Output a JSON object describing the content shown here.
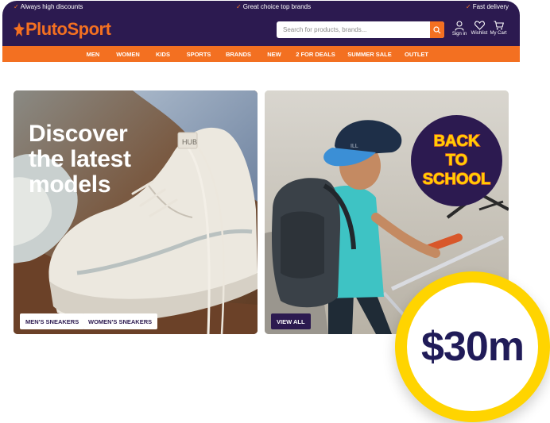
{
  "header": {
    "usps": [
      "Always high discounts",
      "Great choice top brands",
      "Fast delivery"
    ],
    "logo_text": "PlutoSport",
    "search": {
      "placeholder": "Search for products, brands..."
    },
    "account": {
      "signin_label": "Sign in",
      "wishlist_label": "Wishlist",
      "cart_label": "My Cart"
    },
    "nav": [
      "MEN",
      "WOMEN",
      "KIDS",
      "SPORTS",
      "BRANDS",
      "NEW",
      "2 FOR DEALS",
      "SUMMER SALE",
      "OUTLET"
    ]
  },
  "banners": {
    "left": {
      "headline": [
        "Discover",
        "the latest",
        "models"
      ],
      "buttons": [
        "MEN'S SNEAKERS",
        "WOMEN'S SNEAKERS"
      ],
      "shoe_label": "HUB"
    },
    "right": {
      "badge_lines": [
        "BACK",
        "TO",
        "SCHOOL"
      ],
      "button": "VIEW ALL"
    }
  },
  "promo_badge": {
    "text": "$30m"
  },
  "colors": {
    "brand_purple": "#2c1a50",
    "brand_orange": "#f37021",
    "badge_yellow": "#ffd400",
    "badge_text": "#201b58"
  },
  "icons": [
    "check-icon",
    "search-icon",
    "user-icon",
    "heart-icon",
    "cart-icon"
  ]
}
